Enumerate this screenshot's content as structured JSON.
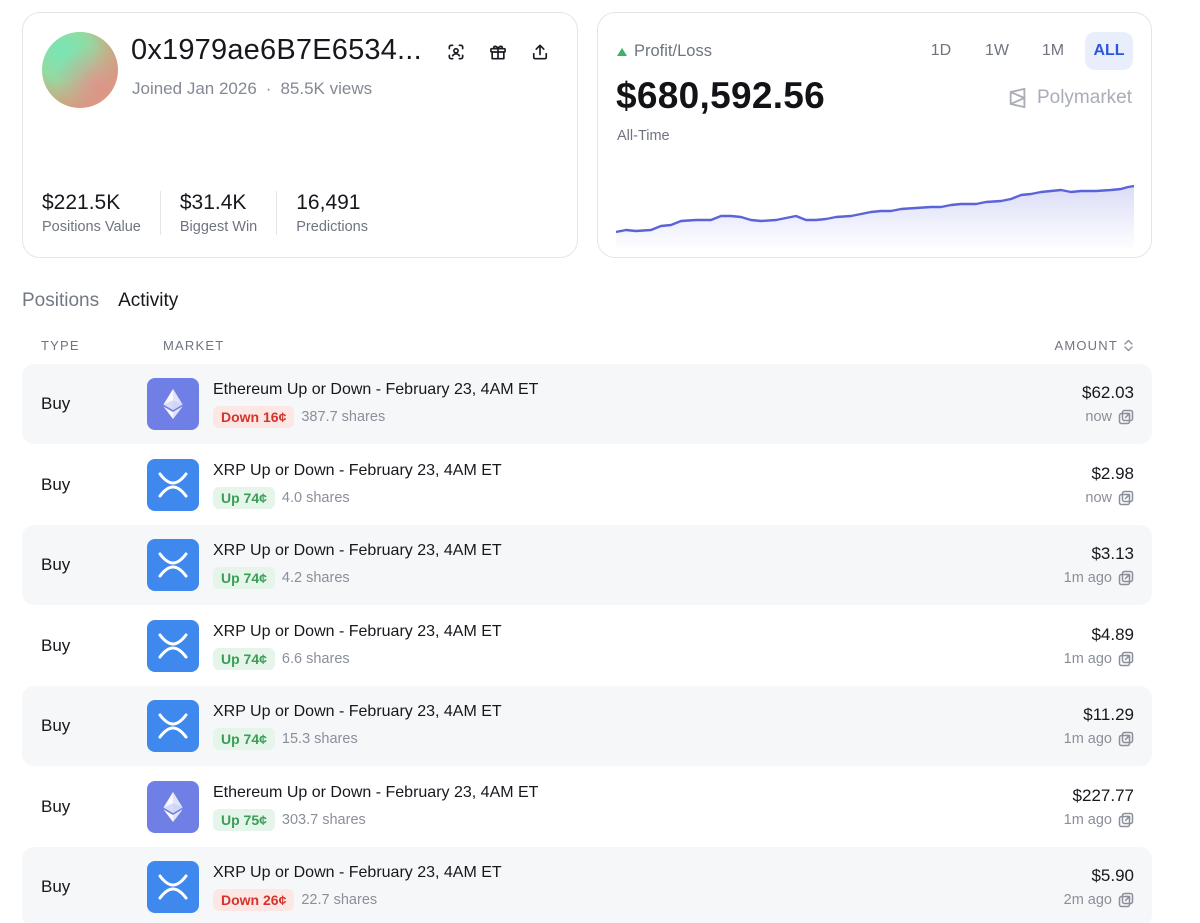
{
  "profile": {
    "wallet": "0x1979ae6B7E6534...",
    "joined": "Joined Jan 2026",
    "separator": "·",
    "views": "85.5K views",
    "stats": [
      {
        "value": "$221.5K",
        "label": "Positions Value"
      },
      {
        "value": "$31.4K",
        "label": "Biggest Win"
      },
      {
        "value": "16,491",
        "label": "Predictions"
      }
    ],
    "actions": [
      "scan-icon",
      "gift-icon",
      "share-icon"
    ]
  },
  "pnl": {
    "label": "Profit/Loss",
    "value": "$680,592.56",
    "period": "All-Time",
    "brand": "Polymarket",
    "ranges": [
      "1D",
      "1W",
      "1M",
      "ALL"
    ],
    "active_range": "ALL",
    "line_color": "#5b63d9"
  },
  "tabs": {
    "positions": "Positions",
    "activity": "Activity",
    "active": "Activity"
  },
  "table": {
    "headers": {
      "type": "TYPE",
      "market": "MARKET",
      "amount": "AMOUNT"
    },
    "rows": [
      {
        "type": "Buy",
        "coin": "eth",
        "market": "Ethereum Up or Down - February 23, 4AM ET",
        "outcome": "Down 16¢",
        "direction": "down",
        "shares": "387.7 shares",
        "amount": "$62.03",
        "time": "now"
      },
      {
        "type": "Buy",
        "coin": "xrp",
        "market": "XRP Up or Down - February 23, 4AM ET",
        "outcome": "Up 74¢",
        "direction": "up",
        "shares": "4.0 shares",
        "amount": "$2.98",
        "time": "now"
      },
      {
        "type": "Buy",
        "coin": "xrp",
        "market": "XRP Up or Down - February 23, 4AM ET",
        "outcome": "Up 74¢",
        "direction": "up",
        "shares": "4.2 shares",
        "amount": "$3.13",
        "time": "1m ago"
      },
      {
        "type": "Buy",
        "coin": "xrp",
        "market": "XRP Up or Down - February 23, 4AM ET",
        "outcome": "Up 74¢",
        "direction": "up",
        "shares": "6.6 shares",
        "amount": "$4.89",
        "time": "1m ago"
      },
      {
        "type": "Buy",
        "coin": "xrp",
        "market": "XRP Up or Down - February 23, 4AM ET",
        "outcome": "Up 74¢",
        "direction": "up",
        "shares": "15.3 shares",
        "amount": "$11.29",
        "time": "1m ago"
      },
      {
        "type": "Buy",
        "coin": "eth",
        "market": "Ethereum Up or Down - February 23, 4AM ET",
        "outcome": "Up 75¢",
        "direction": "up",
        "shares": "303.7 shares",
        "amount": "$227.77",
        "time": "1m ago"
      },
      {
        "type": "Buy",
        "coin": "xrp",
        "market": "XRP Up or Down - February 23, 4AM ET",
        "outcome": "Down 26¢",
        "direction": "down",
        "shares": "22.7 shares",
        "amount": "$5.90",
        "time": "2m ago"
      }
    ]
  }
}
